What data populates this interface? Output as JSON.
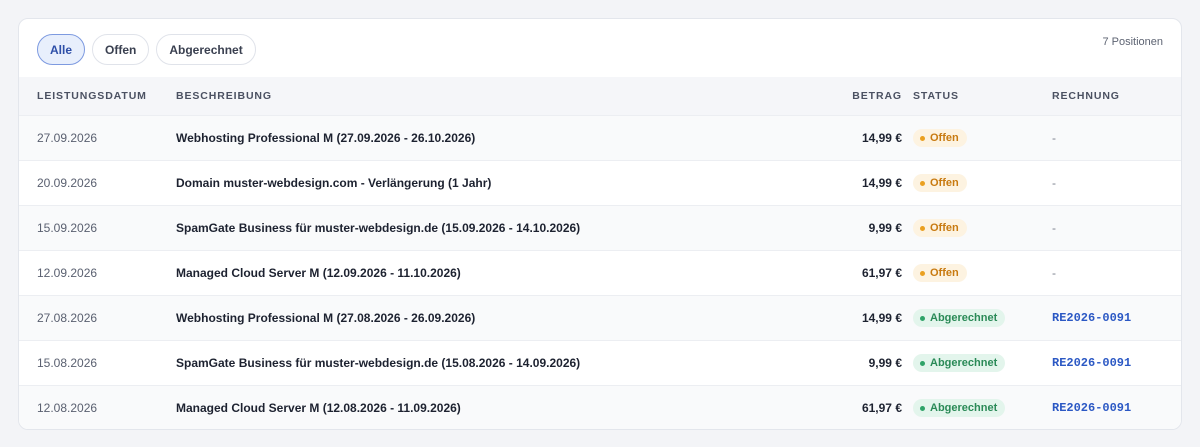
{
  "filters": {
    "all": "Alle",
    "open": "Offen",
    "billed": "Abgerechnet",
    "active": "all"
  },
  "count_label": "7 Positionen",
  "columns": {
    "date": "LEISTUNGSDATUM",
    "description": "BESCHREIBUNG",
    "amount": "BETRAG",
    "status": "STATUS",
    "invoice": "RECHNUNG"
  },
  "rows": [
    {
      "date": "27.09.2026",
      "description": "Webhosting Professional M (27.09.2026 - 26.10.2026)",
      "amount": "14,99 €",
      "status": "Offen",
      "status_type": "open",
      "invoice": "-"
    },
    {
      "date": "20.09.2026",
      "description": "Domain muster-webdesign.com - Verlängerung (1 Jahr)",
      "amount": "14,99 €",
      "status": "Offen",
      "status_type": "open",
      "invoice": "-"
    },
    {
      "date": "15.09.2026",
      "description": "SpamGate Business für muster-webdesign.de (15.09.2026 - 14.10.2026)",
      "amount": "9,99 €",
      "status": "Offen",
      "status_type": "open",
      "invoice": "-"
    },
    {
      "date": "12.09.2026",
      "description": "Managed Cloud Server M (12.09.2026 - 11.10.2026)",
      "amount": "61,97 €",
      "status": "Offen",
      "status_type": "open",
      "invoice": "-"
    },
    {
      "date": "27.08.2026",
      "description": "Webhosting Professional M (27.08.2026 - 26.09.2026)",
      "amount": "14,99 €",
      "status": "Abgerechnet",
      "status_type": "done",
      "invoice": "RE2026-0091"
    },
    {
      "date": "15.08.2026",
      "description": "SpamGate Business für muster-webdesign.de (15.08.2026 - 14.09.2026)",
      "amount": "9,99 €",
      "status": "Abgerechnet",
      "status_type": "done",
      "invoice": "RE2026-0091"
    },
    {
      "date": "12.08.2026",
      "description": "Managed Cloud Server M (12.08.2026 - 11.09.2026)",
      "amount": "61,97 €",
      "status": "Abgerechnet",
      "status_type": "done",
      "invoice": "RE2026-0091"
    }
  ],
  "colors": {
    "accent": "#2b58c4",
    "open": "#c87a10",
    "done": "#2a8a57"
  }
}
